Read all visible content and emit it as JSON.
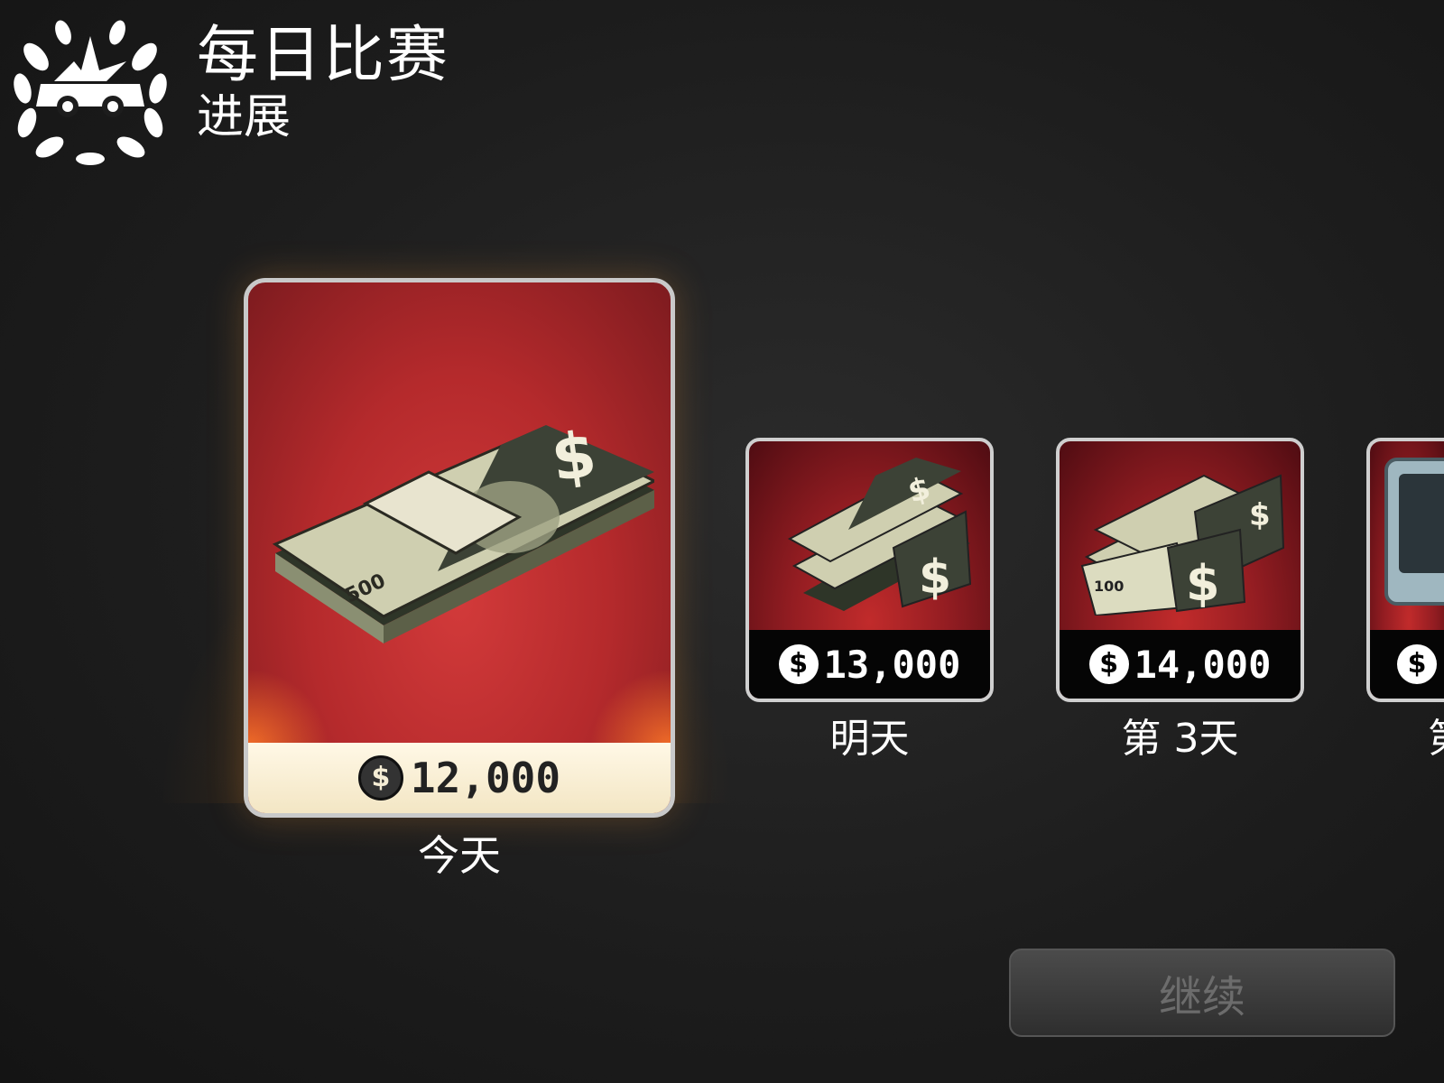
{
  "header": {
    "title": "每日比赛",
    "subtitle": "进展"
  },
  "rewards": [
    {
      "amount": "12,000",
      "day_label": "今天",
      "state": "current"
    },
    {
      "amount": "13,000",
      "day_label": "明天",
      "state": "upcoming"
    },
    {
      "amount": "14,000",
      "day_label": "第 3天",
      "state": "upcoming"
    },
    {
      "amount": "$",
      "day_label": "第",
      "state": "upcoming-partial"
    }
  ],
  "currency_symbol": "$",
  "continue_button": {
    "label": "继续",
    "enabled": false
  },
  "colors": {
    "background": "#1d1d1d",
    "card_red": "#c12b2b",
    "card_footer_current": "#fff8e6",
    "card_footer_upcoming": "#050505",
    "continue_text_disabled": "#6c6c6c"
  },
  "icons": {
    "emblem": "laurel-wreath-car-emblem-icon",
    "coin": "dollar-coin-icon",
    "reward_art": "cash-stack-icon",
    "reward_art_partial": "cash-briefcase-icon"
  }
}
